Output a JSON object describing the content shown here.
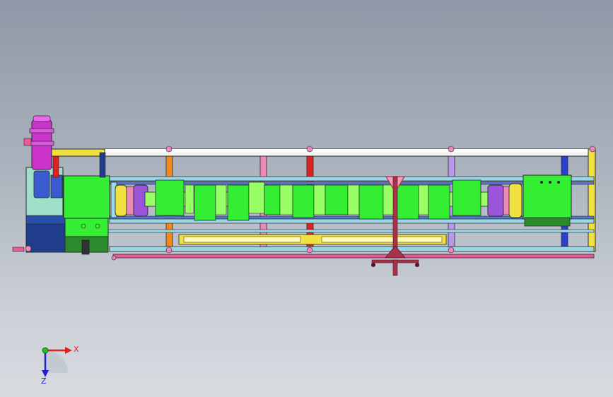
{
  "scene": {
    "description_label": "",
    "colors": {
      "frame_white": "#f4f4f4",
      "frame_outline": "#2a2a2a",
      "rail_blue": "#5a78c8",
      "crank_green": "#33ee33",
      "crank_light": "#99ff66",
      "motor_purple": "#cc33cc",
      "motor_blue": "#3a5ad0",
      "base_navy": "#1f3d8a",
      "base_mint": "#9fe0c8",
      "chuck_yellow": "#f0e040",
      "disc_violet": "#9a55d8",
      "post_orange": "#f08a1a",
      "post_pink": "#ee88b8",
      "post_red": "#e02020",
      "post_lavender": "#b898e8",
      "post_blue": "#2a40d0",
      "bar_cyan": "#9ad8e8",
      "bar_pink": "#e85a9a",
      "stand_maroon": "#a8324a"
    }
  },
  "triad": {
    "x_label": "X",
    "z_label": "Z",
    "x_color": "#e02020",
    "z_color": "#2020d0",
    "y_color": "#20c020"
  }
}
